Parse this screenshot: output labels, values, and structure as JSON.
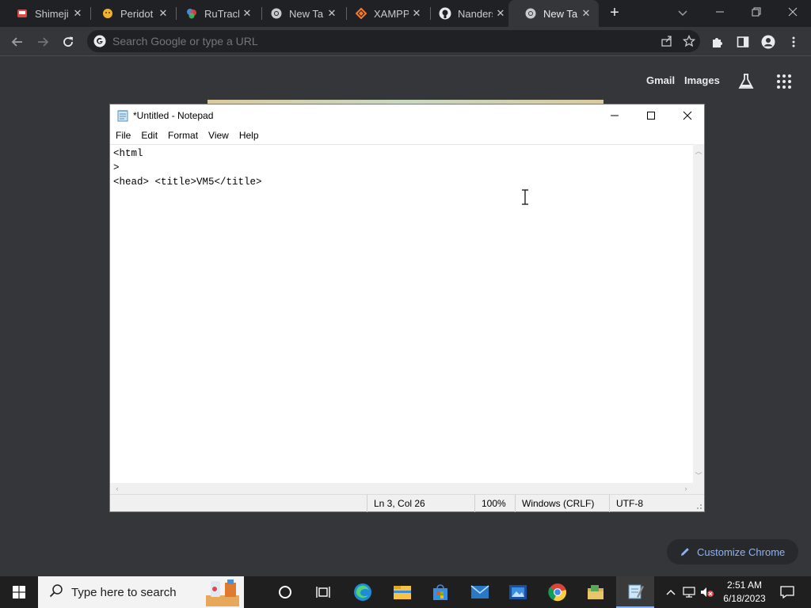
{
  "browser": {
    "tabs": [
      {
        "title": "Shimeji",
        "icon": "shimeji-icon"
      },
      {
        "title": "Peridot",
        "icon": "peridot-icon"
      },
      {
        "title": "RuTracker",
        "icon": "rutracker-icon"
      },
      {
        "title": "New Tab",
        "icon": "chrome-icon"
      },
      {
        "title": "XAMPP",
        "icon": "xampp-icon"
      },
      {
        "title": "Nanderson",
        "icon": "github-icon"
      },
      {
        "title": "New Tab",
        "icon": "chrome-icon",
        "active": true
      }
    ],
    "omnibox": {
      "placeholder": "Search Google or type a URL",
      "value": ""
    },
    "ntp": {
      "gmail": "Gmail",
      "images": "Images"
    },
    "customize_label": "Customize Chrome",
    "colors": {
      "frame": "#202124",
      "toolbar": "#35363a",
      "accent": "#8ab4f8"
    }
  },
  "notepad": {
    "title": "*Untitled - Notepad",
    "menu": [
      "File",
      "Edit",
      "Format",
      "View",
      "Help"
    ],
    "content": "<html\n>\n<head> <title>VM5</title>",
    "status": {
      "position": "Ln 3, Col 26",
      "zoom": "100%",
      "line_ending": "Windows (CRLF)",
      "encoding": "UTF-8"
    }
  },
  "taskbar": {
    "search_placeholder": "Type here to search",
    "apps": [
      "cortana-icon",
      "task-view-icon",
      "edge-icon",
      "file-explorer-icon",
      "store-icon",
      "mail-icon",
      "media-icon",
      "chrome-icon",
      "folder-app-icon",
      "notepad-icon"
    ],
    "clock": {
      "time": "2:51 AM",
      "date": "6/18/2023"
    }
  }
}
